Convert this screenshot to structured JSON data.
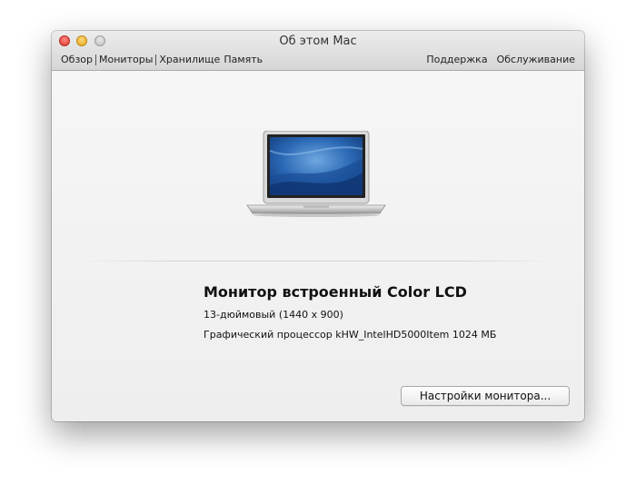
{
  "window": {
    "title": "Об этом Mac"
  },
  "tabs": {
    "left": [
      "Обзор",
      "Мониторы",
      "Хранилище",
      "Память"
    ],
    "right": [
      "Поддержка",
      "Обслуживание"
    ],
    "selected": "Мониторы"
  },
  "display": {
    "name": "Монитор встроенный Color LCD",
    "size_resolution": "13-дюймовый (1440 x 900)",
    "graphics": "Графический процессор kHW_IntelHD5000Item 1024 МБ",
    "settings_button": "Настройки монитора..."
  },
  "icons": {
    "laptop": "macbook-air-icon",
    "close": "close-button-icon",
    "minimize": "minimize-button-icon",
    "zoom": "zoom-button-icon"
  },
  "colors": {
    "close": "#e0443e",
    "minimize": "#f2b63a",
    "zoom": "#c4c4c4",
    "background": "#ededed"
  }
}
